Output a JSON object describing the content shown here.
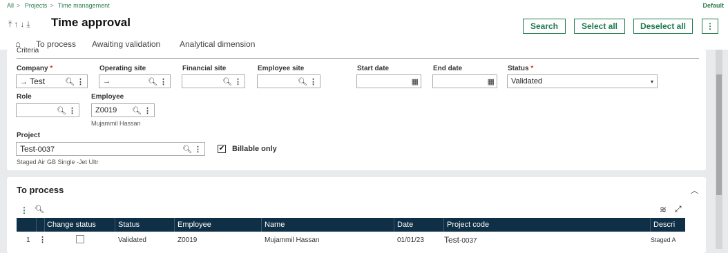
{
  "breadcrumb": {
    "items": [
      "All",
      "Projects",
      "Time management"
    ],
    "sep": ">"
  },
  "top_right": "Default",
  "page_title": "Time approval",
  "buttons": {
    "search": "Search",
    "select_all": "Select all",
    "deselect_all": "Deselect all",
    "more": "⋮"
  },
  "tabs": [
    "To process",
    "Awaiting validation",
    "Analytical dimension"
  ],
  "criteria": {
    "label": "Criteria",
    "company": {
      "label": "Company",
      "value": "Test"
    },
    "operating_site": {
      "label": "Operating site",
      "value": ""
    },
    "financial_site": {
      "label": "Financial site",
      "value": ""
    },
    "employee_site": {
      "label": "Employee site",
      "value": ""
    },
    "start_date": {
      "label": "Start date",
      "value": ""
    },
    "end_date": {
      "label": "End date",
      "value": ""
    },
    "status": {
      "label": "Status",
      "value": "Validated"
    },
    "role": {
      "label": "Role",
      "value": ""
    },
    "employee": {
      "label": "Employee",
      "value": "Z0019",
      "sub": "Mujammil Hassan"
    },
    "project": {
      "label": "Project",
      "value_main": "Test",
      "value_suffix": "-0037",
      "sub": "Staged Air GB Single -Jet Ultr"
    },
    "billable_only": {
      "label": "Billable only",
      "checked": true
    }
  },
  "to_process": {
    "title": "To process",
    "columns": [
      "Change status",
      "Status",
      "Employee",
      "Name",
      "Date",
      "Project code",
      "Descri"
    ],
    "rows": [
      {
        "num": "1",
        "status": "Validated",
        "employee": "Z0019",
        "name": "Mujammil Hassan",
        "date": "01/01/23",
        "project_main": "Test",
        "project_suffix": "-0037",
        "description": "Staged A"
      }
    ]
  }
}
